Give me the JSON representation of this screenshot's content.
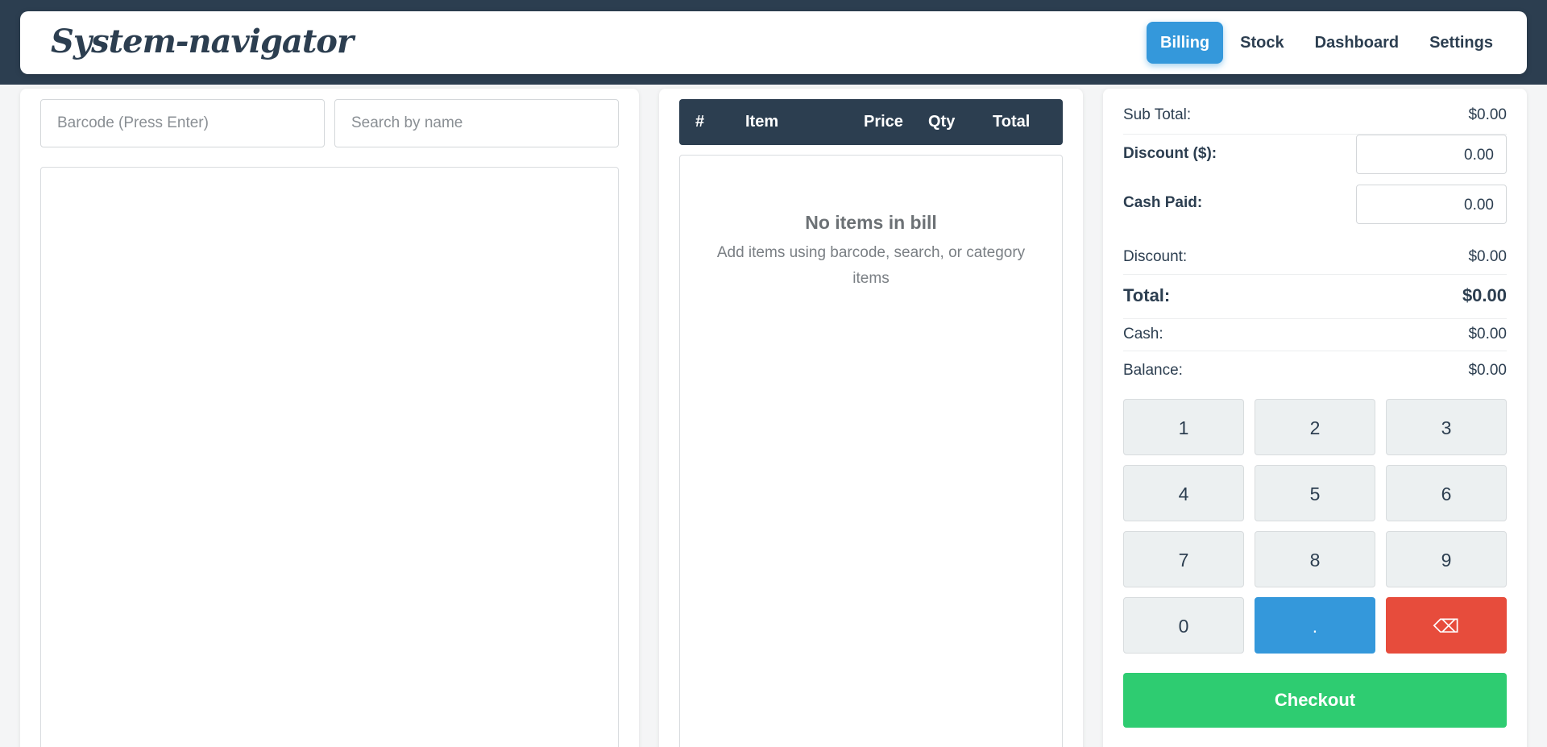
{
  "app": {
    "brand": "System-navigator"
  },
  "nav": {
    "items": [
      {
        "label": "Billing",
        "active": true
      },
      {
        "label": "Stock"
      },
      {
        "label": "Dashboard"
      },
      {
        "label": "Settings"
      }
    ]
  },
  "search": {
    "barcode_placeholder": "Barcode (Press Enter)",
    "name_placeholder": "Search by name"
  },
  "bill": {
    "columns": [
      "#",
      "Item",
      "Price",
      "Qty",
      "Total"
    ],
    "empty_title": "No items in bill",
    "empty_subtitle": "Add items using barcode, search, or category items"
  },
  "summary": {
    "subtotal_label": "Sub Total:",
    "subtotal_value": "$0.00",
    "discount_input_label": "Discount ($):",
    "discount_input_value": "0.00",
    "cash_paid_label": "Cash Paid:",
    "cash_paid_value": "0.00",
    "discount_label": "Discount:",
    "discount_value": "$0.00",
    "total_label": "Total:",
    "total_value": "$0.00",
    "cash_label": "Cash:",
    "cash_value": "$0.00",
    "balance_label": "Balance:",
    "balance_value": "$0.00"
  },
  "keypad": {
    "keys": [
      "1",
      "2",
      "3",
      "4",
      "5",
      "6",
      "7",
      "8",
      "9",
      "0",
      ".",
      "⌫"
    ]
  },
  "checkout": {
    "label": "Checkout"
  },
  "colors": {
    "header": "#2c3e50",
    "accent": "#3498db",
    "danger": "#e74c3c",
    "success": "#2ecc71"
  }
}
